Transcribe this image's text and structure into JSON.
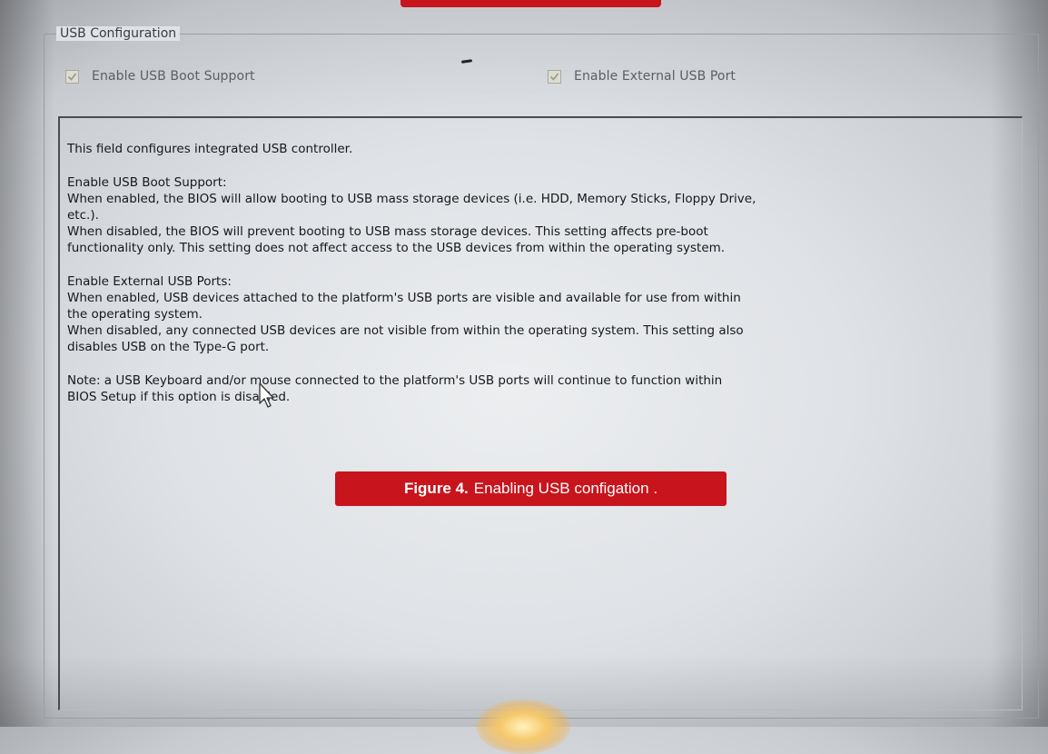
{
  "group": {
    "title": "USB Configuration"
  },
  "options": [
    {
      "label": "Enable USB Boot Support",
      "checked": true
    },
    {
      "label": "Enable External USB Port",
      "checked": true
    }
  ],
  "help": {
    "intro": "This field configures integrated USB controller.",
    "boot_heading": "Enable USB Boot Support:",
    "boot_line1": "When enabled, the BIOS will allow booting to USB mass storage devices (i.e. HDD, Memory Sticks, Floppy Drive,",
    "boot_line2": " etc.).",
    "boot_line3": "When disabled, the BIOS will prevent booting to USB mass storage devices. This setting affects pre-boot",
    "boot_line4": "functionality only. This setting does not affect access to the USB devices from within the operating system.",
    "ext_heading": "Enable External USB Ports:",
    "ext_line1": "When enabled, USB devices attached to the platform's USB ports are visible and available for use from within",
    "ext_line2": "the operating system.",
    "ext_line3": "When disabled, any connected USB devices are not visible from within the operating system. This setting also",
    "ext_line4": "disables USB on the Type-G port.",
    "note_line1": "Note: a USB Keyboard and/or mouse connected to the platform's USB ports will continue to function within",
    "note_line2": "BIOS Setup if this option is disabled."
  },
  "caption": {
    "figure": "Figure 4.",
    "text": "Enabling USB configation ."
  },
  "colors": {
    "caption_bg": "#c8141c",
    "checkbox_tick": "#9a9a80"
  }
}
